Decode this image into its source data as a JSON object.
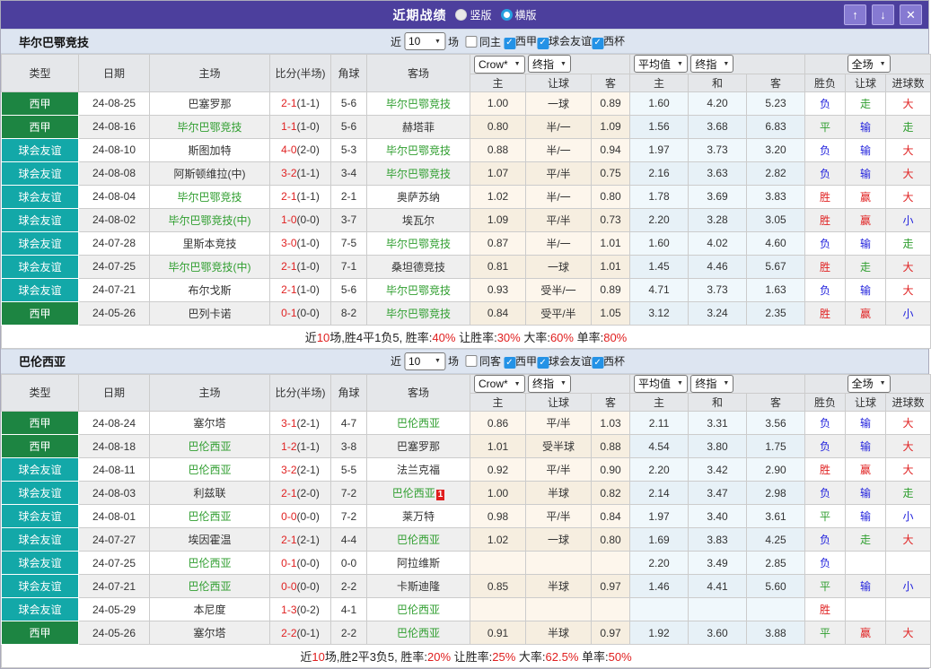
{
  "icons": {
    "caret": "▼",
    "check": "✓",
    "up_arrow": "↑",
    "down_arrow": "↓",
    "close": "✕"
  },
  "colors": {
    "topbar": "#4c3f9d",
    "badge_liga": "#1d8542",
    "badge_friendly": "#13a8a8",
    "team_highlight": "#2f9e2f",
    "score_red": "#e02222",
    "result_win": "#e02222",
    "result_draw": "#2f9e2f",
    "result_lose": "#2323dd"
  },
  "result_colors": {
    "胜": "#e02222",
    "平": "#2f9e2f",
    "负": "#2323dd",
    "赢": "#e02222",
    "走": "#2f9e2f",
    "输": "#2323dd",
    "大": "#e02222",
    "小": "#2323dd"
  },
  "titlebar": {
    "title": "近期战绩",
    "radios": [
      {
        "label": "竖版",
        "checked": false
      },
      {
        "label": "横版",
        "checked": true
      }
    ]
  },
  "table_header": {
    "type": "类型",
    "date": "日期",
    "home": "主场",
    "score": "比分(半场)",
    "corner": "角球",
    "away": "客场",
    "odds_selects": [
      "Crow*",
      "终指"
    ],
    "odds_cols": [
      "主",
      "让球",
      "客"
    ],
    "avg_selects": [
      "平均值",
      "终指"
    ],
    "avg_cols": [
      "主",
      "和",
      "客"
    ],
    "full_select": "全场",
    "result_cols": [
      "胜负",
      "让球",
      "进球数"
    ]
  },
  "sections": [
    {
      "team": "毕尔巴鄂竞技",
      "filter": {
        "near": "近",
        "count": "10",
        "games": "场",
        "same": "同主",
        "same_checked": false,
        "leagues": [
          {
            "label": "西甲",
            "checked": true
          },
          {
            "label": "球会友谊",
            "checked": true
          },
          {
            "label": "西杯",
            "checked": true
          }
        ]
      },
      "rows": [
        {
          "league": "西甲",
          "lt": "liga",
          "date": "24-08-25",
          "home": "巴塞罗那",
          "hh": false,
          "ft": "2-1",
          "ht": "(1-1)",
          "corner": "5-6",
          "away": "毕尔巴鄂竞技",
          "ah": true,
          "odds": [
            "1.00",
            "一球",
            "0.89"
          ],
          "avg": [
            "1.60",
            "4.20",
            "5.23"
          ],
          "res": [
            "负",
            "走",
            "大"
          ]
        },
        {
          "league": "西甲",
          "lt": "liga",
          "date": "24-08-16",
          "home": "毕尔巴鄂竞技",
          "hh": true,
          "ft": "1-1",
          "ht": "(1-0)",
          "corner": "5-6",
          "away": "赫塔菲",
          "ah": false,
          "odds": [
            "0.80",
            "半/一",
            "1.09"
          ],
          "avg": [
            "1.56",
            "3.68",
            "6.83"
          ],
          "res": [
            "平",
            "输",
            "走"
          ]
        },
        {
          "league": "球会友谊",
          "lt": "friendly",
          "date": "24-08-10",
          "home": "斯图加特",
          "hh": false,
          "ft": "4-0",
          "ht": "(2-0)",
          "corner": "5-3",
          "away": "毕尔巴鄂竞技",
          "ah": true,
          "odds": [
            "0.88",
            "半/一",
            "0.94"
          ],
          "avg": [
            "1.97",
            "3.73",
            "3.20"
          ],
          "res": [
            "负",
            "输",
            "大"
          ]
        },
        {
          "league": "球会友谊",
          "lt": "friendly",
          "date": "24-08-08",
          "home": "阿斯顿维拉(中)",
          "hh": false,
          "ft": "3-2",
          "ht": "(1-1)",
          "corner": "3-4",
          "away": "毕尔巴鄂竞技",
          "ah": true,
          "odds": [
            "1.07",
            "平/半",
            "0.75"
          ],
          "avg": [
            "2.16",
            "3.63",
            "2.82"
          ],
          "res": [
            "负",
            "输",
            "大"
          ]
        },
        {
          "league": "球会友谊",
          "lt": "friendly",
          "date": "24-08-04",
          "home": "毕尔巴鄂竞技",
          "hh": true,
          "ft": "2-1",
          "ht": "(1-1)",
          "corner": "2-1",
          "away": "奥萨苏纳",
          "ah": false,
          "odds": [
            "1.02",
            "半/一",
            "0.80"
          ],
          "avg": [
            "1.78",
            "3.69",
            "3.83"
          ],
          "res": [
            "胜",
            "赢",
            "大"
          ]
        },
        {
          "league": "球会友谊",
          "lt": "friendly",
          "date": "24-08-02",
          "home": "毕尔巴鄂竞技(中)",
          "hh": true,
          "ft": "1-0",
          "ht": "(0-0)",
          "corner": "3-7",
          "away": "埃瓦尔",
          "ah": false,
          "odds": [
            "1.09",
            "平/半",
            "0.73"
          ],
          "avg": [
            "2.20",
            "3.28",
            "3.05"
          ],
          "res": [
            "胜",
            "赢",
            "小"
          ]
        },
        {
          "league": "球会友谊",
          "lt": "friendly",
          "date": "24-07-28",
          "home": "里斯本竞技",
          "hh": false,
          "ft": "3-0",
          "ht": "(1-0)",
          "corner": "7-5",
          "away": "毕尔巴鄂竞技",
          "ah": true,
          "odds": [
            "0.87",
            "半/一",
            "1.01"
          ],
          "avg": [
            "1.60",
            "4.02",
            "4.60"
          ],
          "res": [
            "负",
            "输",
            "走"
          ]
        },
        {
          "league": "球会友谊",
          "lt": "friendly",
          "date": "24-07-25",
          "home": "毕尔巴鄂竞技(中)",
          "hh": true,
          "ft": "2-1",
          "ht": "(1-0)",
          "corner": "7-1",
          "away": "桑坦德竞技",
          "ah": false,
          "odds": [
            "0.81",
            "一球",
            "1.01"
          ],
          "avg": [
            "1.45",
            "4.46",
            "5.67"
          ],
          "res": [
            "胜",
            "走",
            "大"
          ]
        },
        {
          "league": "球会友谊",
          "lt": "friendly",
          "date": "24-07-21",
          "home": "布尔戈斯",
          "hh": false,
          "ft": "2-1",
          "ht": "(1-0)",
          "corner": "5-6",
          "away": "毕尔巴鄂竞技",
          "ah": true,
          "odds": [
            "0.93",
            "受半/一",
            "0.89"
          ],
          "avg": [
            "4.71",
            "3.73",
            "1.63"
          ],
          "res": [
            "负",
            "输",
            "大"
          ]
        },
        {
          "league": "西甲",
          "lt": "liga",
          "date": "24-05-26",
          "home": "巴列卡诺",
          "hh": false,
          "ft": "0-1",
          "ht": "(0-0)",
          "corner": "8-2",
          "away": "毕尔巴鄂竞技",
          "ah": true,
          "odds": [
            "0.84",
            "受平/半",
            "1.05"
          ],
          "avg": [
            "3.12",
            "3.24",
            "2.35"
          ],
          "res": [
            "胜",
            "赢",
            "小"
          ]
        }
      ],
      "summary": [
        {
          "t": "近"
        },
        {
          "t": "10",
          "r": true
        },
        {
          "t": "场,胜4平1负5, 胜率:"
        },
        {
          "t": "40%",
          "r": true
        },
        {
          "t": " 让胜率:"
        },
        {
          "t": "30%",
          "r": true
        },
        {
          "t": " 大率:"
        },
        {
          "t": "60%",
          "r": true
        },
        {
          "t": " 单率:"
        },
        {
          "t": "80%",
          "r": true
        }
      ]
    },
    {
      "team": "巴伦西亚",
      "filter": {
        "near": "近",
        "count": "10",
        "games": "场",
        "same": "同客",
        "same_checked": false,
        "leagues": [
          {
            "label": "西甲",
            "checked": true
          },
          {
            "label": "球会友谊",
            "checked": true
          },
          {
            "label": "西杯",
            "checked": true
          }
        ]
      },
      "rows": [
        {
          "league": "西甲",
          "lt": "liga",
          "date": "24-08-24",
          "home": "塞尔塔",
          "hh": false,
          "ft": "3-1",
          "ht": "(2-1)",
          "corner": "4-7",
          "away": "巴伦西亚",
          "ah": true,
          "odds": [
            "0.86",
            "平/半",
            "1.03"
          ],
          "avg": [
            "2.11",
            "3.31",
            "3.56"
          ],
          "res": [
            "负",
            "输",
            "大"
          ]
        },
        {
          "league": "西甲",
          "lt": "liga",
          "date": "24-08-18",
          "home": "巴伦西亚",
          "hh": true,
          "ft": "1-2",
          "ht": "(1-1)",
          "corner": "3-8",
          "away": "巴塞罗那",
          "ah": false,
          "odds": [
            "1.01",
            "受半球",
            "0.88"
          ],
          "avg": [
            "4.54",
            "3.80",
            "1.75"
          ],
          "res": [
            "负",
            "输",
            "大"
          ]
        },
        {
          "league": "球会友谊",
          "lt": "friendly",
          "date": "24-08-11",
          "home": "巴伦西亚",
          "hh": true,
          "ft": "3-2",
          "ht": "(2-1)",
          "corner": "5-5",
          "away": "法兰克福",
          "ah": false,
          "odds": [
            "0.92",
            "平/半",
            "0.90"
          ],
          "avg": [
            "2.20",
            "3.42",
            "2.90"
          ],
          "res": [
            "胜",
            "赢",
            "大"
          ]
        },
        {
          "league": "球会友谊",
          "lt": "friendly",
          "date": "24-08-03",
          "home": "利兹联",
          "hh": false,
          "ft": "2-1",
          "ht": "(2-0)",
          "corner": "7-2",
          "away": "巴伦西亚",
          "ah": true,
          "abadge": "1",
          "odds": [
            "1.00",
            "半球",
            "0.82"
          ],
          "avg": [
            "2.14",
            "3.47",
            "2.98"
          ],
          "res": [
            "负",
            "输",
            "走"
          ]
        },
        {
          "league": "球会友谊",
          "lt": "friendly",
          "date": "24-08-01",
          "home": "巴伦西亚",
          "hh": true,
          "ft": "0-0",
          "ht": "(0-0)",
          "corner": "7-2",
          "away": "莱万特",
          "ah": false,
          "odds": [
            "0.98",
            "平/半",
            "0.84"
          ],
          "avg": [
            "1.97",
            "3.40",
            "3.61"
          ],
          "res": [
            "平",
            "输",
            "小"
          ]
        },
        {
          "league": "球会友谊",
          "lt": "friendly",
          "date": "24-07-27",
          "home": "埃因霍温",
          "hh": false,
          "ft": "2-1",
          "ht": "(2-1)",
          "corner": "4-4",
          "away": "巴伦西亚",
          "ah": true,
          "odds": [
            "1.02",
            "一球",
            "0.80"
          ],
          "avg": [
            "1.69",
            "3.83",
            "4.25"
          ],
          "res": [
            "负",
            "走",
            "大"
          ]
        },
        {
          "league": "球会友谊",
          "lt": "friendly",
          "date": "24-07-25",
          "home": "巴伦西亚",
          "hh": true,
          "ft": "0-1",
          "ht": "(0-0)",
          "corner": "0-0",
          "away": "阿拉维斯",
          "ah": false,
          "odds": [
            "",
            "",
            ""
          ],
          "avg": [
            "2.20",
            "3.49",
            "2.85"
          ],
          "res": [
            "负",
            "",
            ""
          ]
        },
        {
          "league": "球会友谊",
          "lt": "friendly",
          "date": "24-07-21",
          "home": "巴伦西亚",
          "hh": true,
          "ft": "0-0",
          "ht": "(0-0)",
          "corner": "2-2",
          "away": "卡斯迪隆",
          "ah": false,
          "odds": [
            "0.85",
            "半球",
            "0.97"
          ],
          "avg": [
            "1.46",
            "4.41",
            "5.60"
          ],
          "res": [
            "平",
            "输",
            "小"
          ]
        },
        {
          "league": "球会友谊",
          "lt": "friendly",
          "date": "24-05-29",
          "home": "本尼度",
          "hh": false,
          "ft": "1-3",
          "ht": "(0-2)",
          "corner": "4-1",
          "away": "巴伦西亚",
          "ah": true,
          "odds": [
            "",
            "",
            ""
          ],
          "avg": [
            "",
            "",
            ""
          ],
          "res": [
            "胜",
            "",
            ""
          ]
        },
        {
          "league": "西甲",
          "lt": "liga",
          "date": "24-05-26",
          "home": "塞尔塔",
          "hh": false,
          "ft": "2-2",
          "ht": "(0-1)",
          "corner": "2-2",
          "away": "巴伦西亚",
          "ah": true,
          "odds": [
            "0.91",
            "半球",
            "0.97"
          ],
          "avg": [
            "1.92",
            "3.60",
            "3.88"
          ],
          "res": [
            "平",
            "赢",
            "大"
          ]
        }
      ],
      "summary": [
        {
          "t": "近"
        },
        {
          "t": "10",
          "r": true
        },
        {
          "t": "场,胜2平3负5, 胜率:"
        },
        {
          "t": "20%",
          "r": true
        },
        {
          "t": " 让胜率:"
        },
        {
          "t": "25%",
          "r": true
        },
        {
          "t": " 大率:"
        },
        {
          "t": "62.5%",
          "r": true
        },
        {
          "t": " 单率:"
        },
        {
          "t": "50%",
          "r": true
        }
      ]
    }
  ]
}
